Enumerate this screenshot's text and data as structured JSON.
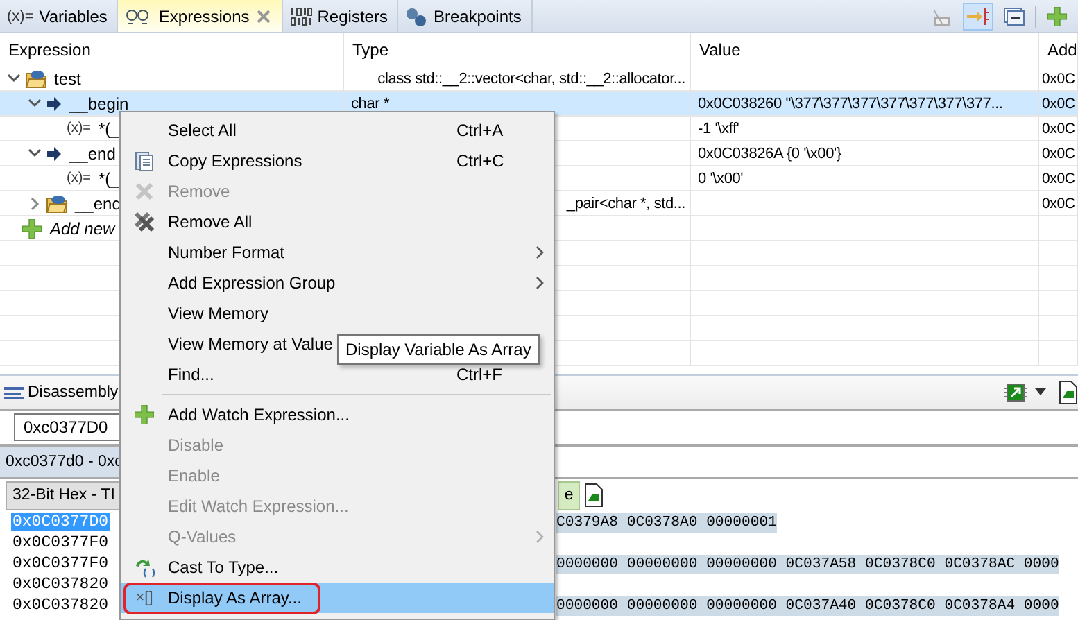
{
  "tabs": [
    {
      "label": "Variables",
      "glyph": "(x)=",
      "selected": false
    },
    {
      "label": "Expressions",
      "selected": true
    },
    {
      "label": "Registers",
      "selected": false
    },
    {
      "label": "Breakpoints",
      "selected": false
    }
  ],
  "toolbar": [
    {
      "pressed": false
    },
    {
      "pressed": true
    },
    {
      "pressed": false
    },
    {
      "pressed": false
    }
  ],
  "expressions": {
    "columns": [
      "Expression",
      "Type",
      "Value",
      "Add"
    ],
    "rows": [
      {
        "kind": "group",
        "name": "test",
        "type": "class std::__2::vector<char, std::__2::allocator...",
        "address": "0x0C",
        "expanded": true,
        "selected": false,
        "children": [
          {
            "kind": "pointer",
            "name": "__begin",
            "type": "char *",
            "value": "0x0C038260 \"\\377\\377\\377\\377\\377\\377\\377...",
            "address": "0x0C",
            "expanded": true,
            "selected": true,
            "children": [
              {
                "kind": "variable",
                "glyph": "(x)=",
                "name": "*(_",
                "value": "-1 '\\xff'",
                "address": "0x0C",
                "selected": false
              }
            ]
          },
          {
            "kind": "pointer",
            "name": "__end",
            "value": "0x0C03826A {0 '\\x00'}",
            "address": "0x0C",
            "expanded": true,
            "selected": false,
            "children": [
              {
                "kind": "variable",
                "glyph": "(x)=",
                "name": "*(_",
                "value": "0 '\\x00'",
                "address": "0x0C",
                "selected": false
              }
            ]
          },
          {
            "kind": "group",
            "name": "__end",
            "type": "_pair<char *, std...",
            "address": "0x0C",
            "expanded": false,
            "selected": false
          }
        ]
      }
    ],
    "add_row": {
      "label": "Add new"
    }
  },
  "memory": {
    "tab": "Disassembly",
    "address": "0xc0377D0",
    "range_tab": "0xc0377d0 - 0xc",
    "renderings": [
      {
        "label": "32-Bit Hex - TI",
        "selected": false
      },
      {
        "label": "e",
        "selected": true
      }
    ],
    "rows": [
      {
        "address": "0x0C0377D0",
        "selected": true,
        "data": "C0379A8 0C0378A0 00000001"
      },
      {
        "address": "0x0C0377F0",
        "selected": false
      },
      {
        "address": "0x0C0377F0",
        "selected": false,
        "data": "0000000 00000000 00000000 0C037A58 0C0378C0 0C0378AC 0000"
      },
      {
        "address": "0x0C037820",
        "selected": false
      },
      {
        "address": "0x0C037820",
        "selected": false,
        "data": "0000000 00000000 00000000 0C037A40 0C0378C0 0C0378A4 0000"
      }
    ]
  },
  "context_menu": {
    "items": [
      {
        "kind": "plain",
        "label": "Select All",
        "shortcut": "Ctrl+A",
        "disabled": false,
        "submenu": false,
        "selected": false
      },
      {
        "kind": "copy",
        "label": "Copy Expressions",
        "shortcut": "Ctrl+C",
        "disabled": false,
        "submenu": false,
        "selected": false
      },
      {
        "kind": "remove",
        "label": "Remove",
        "disabled": true,
        "submenu": false,
        "selected": false
      },
      {
        "kind": "remove-all",
        "label": "Remove All",
        "disabled": false,
        "submenu": false,
        "selected": false
      },
      {
        "kind": "plain",
        "label": "Number Format",
        "disabled": false,
        "submenu": true,
        "selected": false
      },
      {
        "kind": "plain",
        "label": "Add Expression Group",
        "disabled": false,
        "submenu": true,
        "selected": false
      },
      {
        "kind": "plain",
        "label": "View Memory",
        "disabled": false,
        "submenu": false,
        "selected": false
      },
      {
        "kind": "plain",
        "label": "View Memory at Value",
        "disabled": false,
        "submenu": false,
        "selected": false
      },
      {
        "kind": "plain",
        "label": "Find...",
        "shortcut": "Ctrl+F",
        "disabled": false,
        "submenu": false,
        "selected": false
      },
      {
        "kind": "separator"
      },
      {
        "kind": "add",
        "label": "Add Watch Expression...",
        "disabled": false,
        "submenu": false,
        "selected": false
      },
      {
        "kind": "plain",
        "label": "Disable",
        "disabled": true,
        "submenu": false,
        "selected": false
      },
      {
        "kind": "plain",
        "label": "Enable",
        "disabled": true,
        "submenu": false,
        "selected": false
      },
      {
        "kind": "plain",
        "label": "Edit Watch Expression...",
        "disabled": true,
        "submenu": false,
        "selected": false
      },
      {
        "kind": "plain",
        "label": "Q-Values",
        "disabled": true,
        "submenu": true,
        "selected": false
      },
      {
        "kind": "cast",
        "label": "Cast To Type...",
        "disabled": false,
        "submenu": false,
        "selected": false
      },
      {
        "kind": "array",
        "glyph": "×[]",
        "label": "Display As Array...",
        "disabled": false,
        "submenu": false,
        "selected": true
      }
    ]
  },
  "tooltip": {
    "text": "Display Variable As Array"
  }
}
